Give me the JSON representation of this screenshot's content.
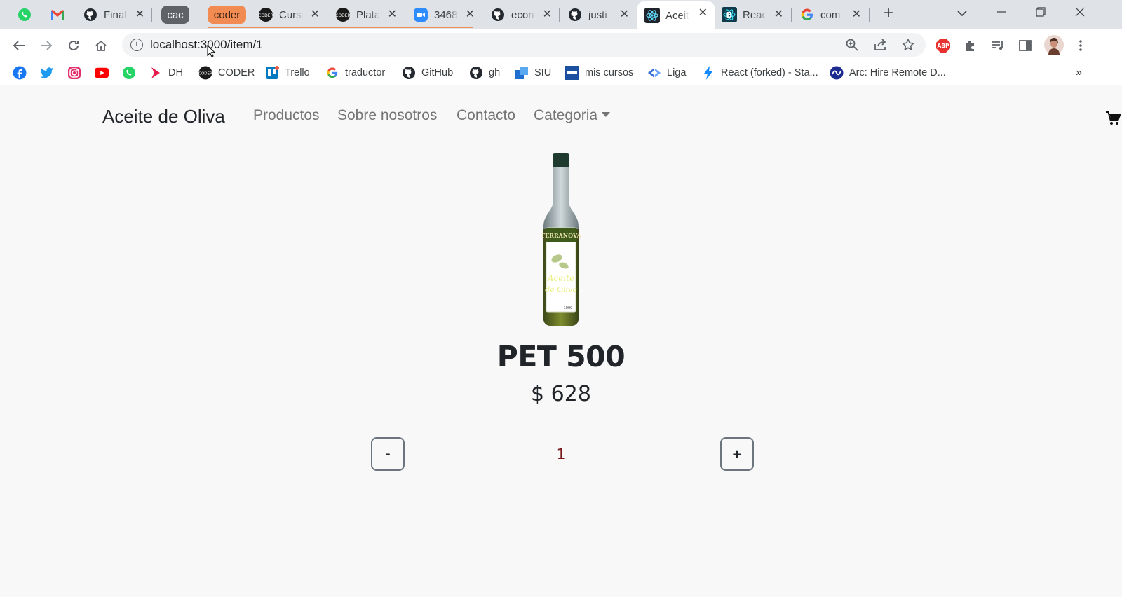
{
  "browser": {
    "tabs": [
      {
        "title": "Final"
      },
      {
        "title": "Curso"
      },
      {
        "title": "Plata"
      },
      {
        "title": "3468"
      },
      {
        "title": "econ"
      },
      {
        "title": "justi"
      },
      {
        "title": "Aceit"
      },
      {
        "title": "Reac"
      },
      {
        "title": "com"
      }
    ],
    "tab_groups": [
      {
        "label": "cac",
        "color": "#5f6368"
      },
      {
        "label": "coder",
        "color": "#f28b51"
      }
    ],
    "close_glyph": "✕",
    "new_tab_glyph": "+",
    "address_bar": {
      "url": "localhost:3000/item/1"
    },
    "bookmarks": [
      {
        "label": "DH"
      },
      {
        "label": "CODER"
      },
      {
        "label": "Trello"
      },
      {
        "label": "traductor"
      },
      {
        "label": "GitHub"
      },
      {
        "label": "gh"
      },
      {
        "label": "SIU"
      },
      {
        "label": "mis cursos"
      },
      {
        "label": "Liga"
      },
      {
        "label": "React (forked) - Sta..."
      },
      {
        "label": "Arc: Hire Remote D..."
      }
    ],
    "bookmarks_overflow": "»",
    "extensions": {
      "abp_label": "ABP"
    }
  },
  "page": {
    "navbar": {
      "brand": "Aceite de Oliva",
      "links": [
        "Productos",
        "Sobre nosotros",
        "Contacto"
      ],
      "dropdown": "Categoria"
    },
    "product": {
      "title": "PET 500",
      "price": "$ 628",
      "image_label": "TERRANOVA",
      "image_volume": "1000"
    },
    "counter": {
      "decrement": "-",
      "value": "1",
      "increment": "+"
    }
  }
}
